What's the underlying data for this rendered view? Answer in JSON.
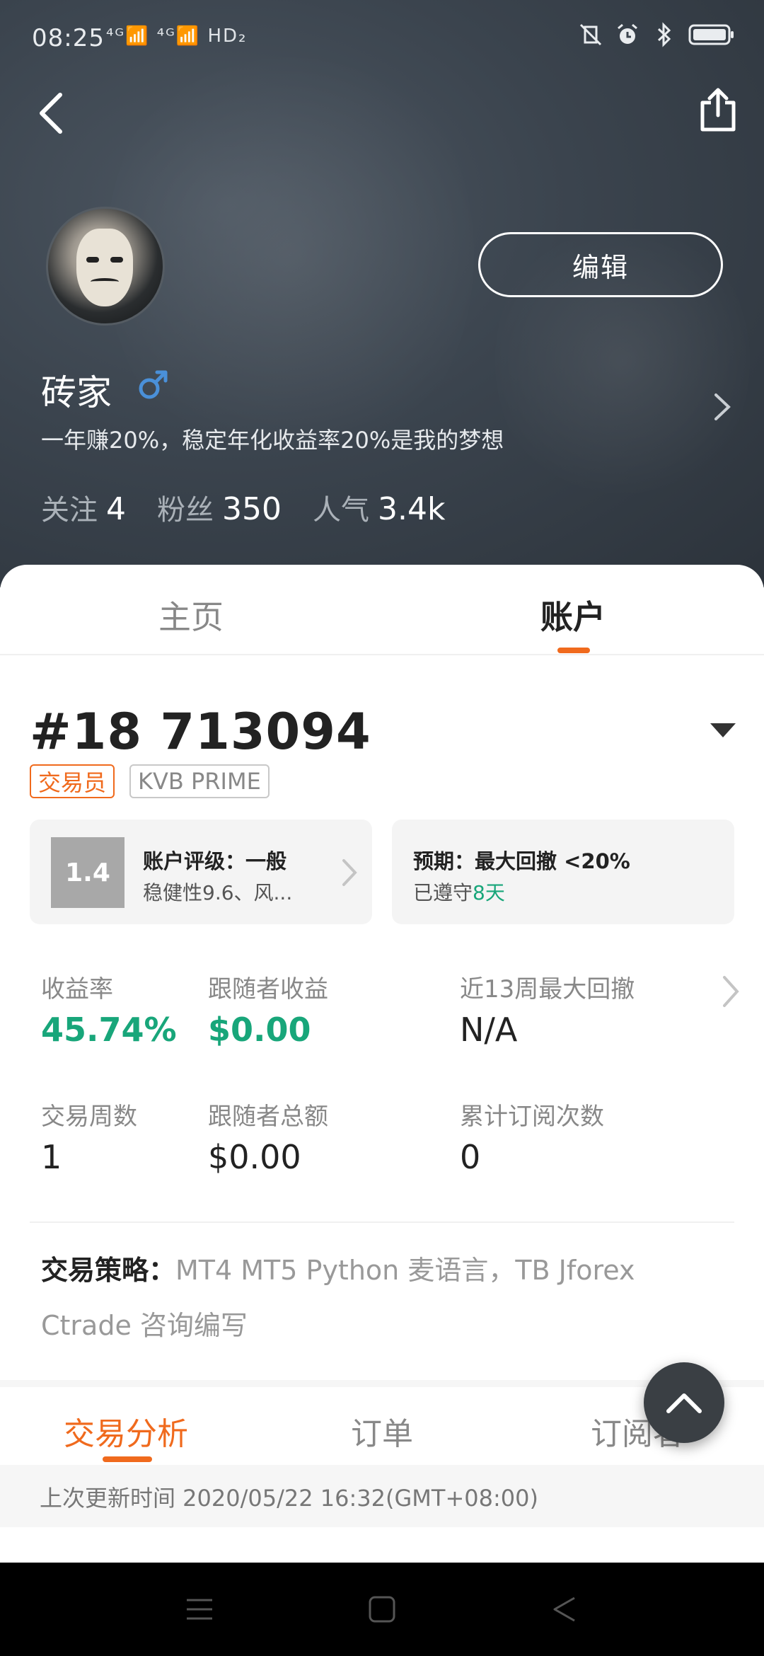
{
  "status_bar": {
    "time": "08:25",
    "network": "⁴ᴳ📶 ⁴ᴳ📶 HD₂"
  },
  "profile": {
    "name": "砖家",
    "bio": "一年赚20%，稳定年化收益率20%是我的梦想",
    "edit_label": "编辑",
    "stats": [
      {
        "label": "关注",
        "value": "4"
      },
      {
        "label": "粉丝",
        "value": "350"
      },
      {
        "label": "人气",
        "value": "3.4k"
      }
    ]
  },
  "main_tabs": [
    {
      "label": "主页",
      "active": false
    },
    {
      "label": "账户",
      "active": true
    }
  ],
  "account": {
    "id": "#18 713094",
    "tags": [
      "交易员",
      "KVB PRIME"
    ],
    "rating_card": {
      "score": "1.4",
      "title": "账户评级：一般",
      "subtitle": "稳健性9.6、风..."
    },
    "expect_card": {
      "title": "预期：最大回撤 <20%",
      "subtitle_prefix": "已遵守",
      "subtitle_highlight": "8天"
    },
    "metrics": [
      {
        "label": "收益率",
        "value": "45.74%"
      },
      {
        "label": "跟随者收益",
        "value": "$0.00"
      },
      {
        "label": "近13周最大回撤",
        "value": "N/A"
      },
      {
        "label": "交易周数",
        "value": "1"
      },
      {
        "label": "跟随者总额",
        "value": "$0.00"
      },
      {
        "label": "累计订阅次数",
        "value": "0"
      }
    ],
    "strategy_label": "交易策略：",
    "strategy_text": "MT4 MT5 Python 麦语言，TB Jforex Ctrade 咨询编写"
  },
  "sub_tabs": [
    {
      "label": "交易分析",
      "active": true
    },
    {
      "label": "订单",
      "active": false
    },
    {
      "label": "订阅者",
      "active": false
    }
  ],
  "last_update": "上次更新时间 2020/05/22 16:32(GMT+08:00)",
  "colors": {
    "accent": "#f06a1d",
    "positive": "#18a67a",
    "hero_bg": "#3b444e"
  }
}
